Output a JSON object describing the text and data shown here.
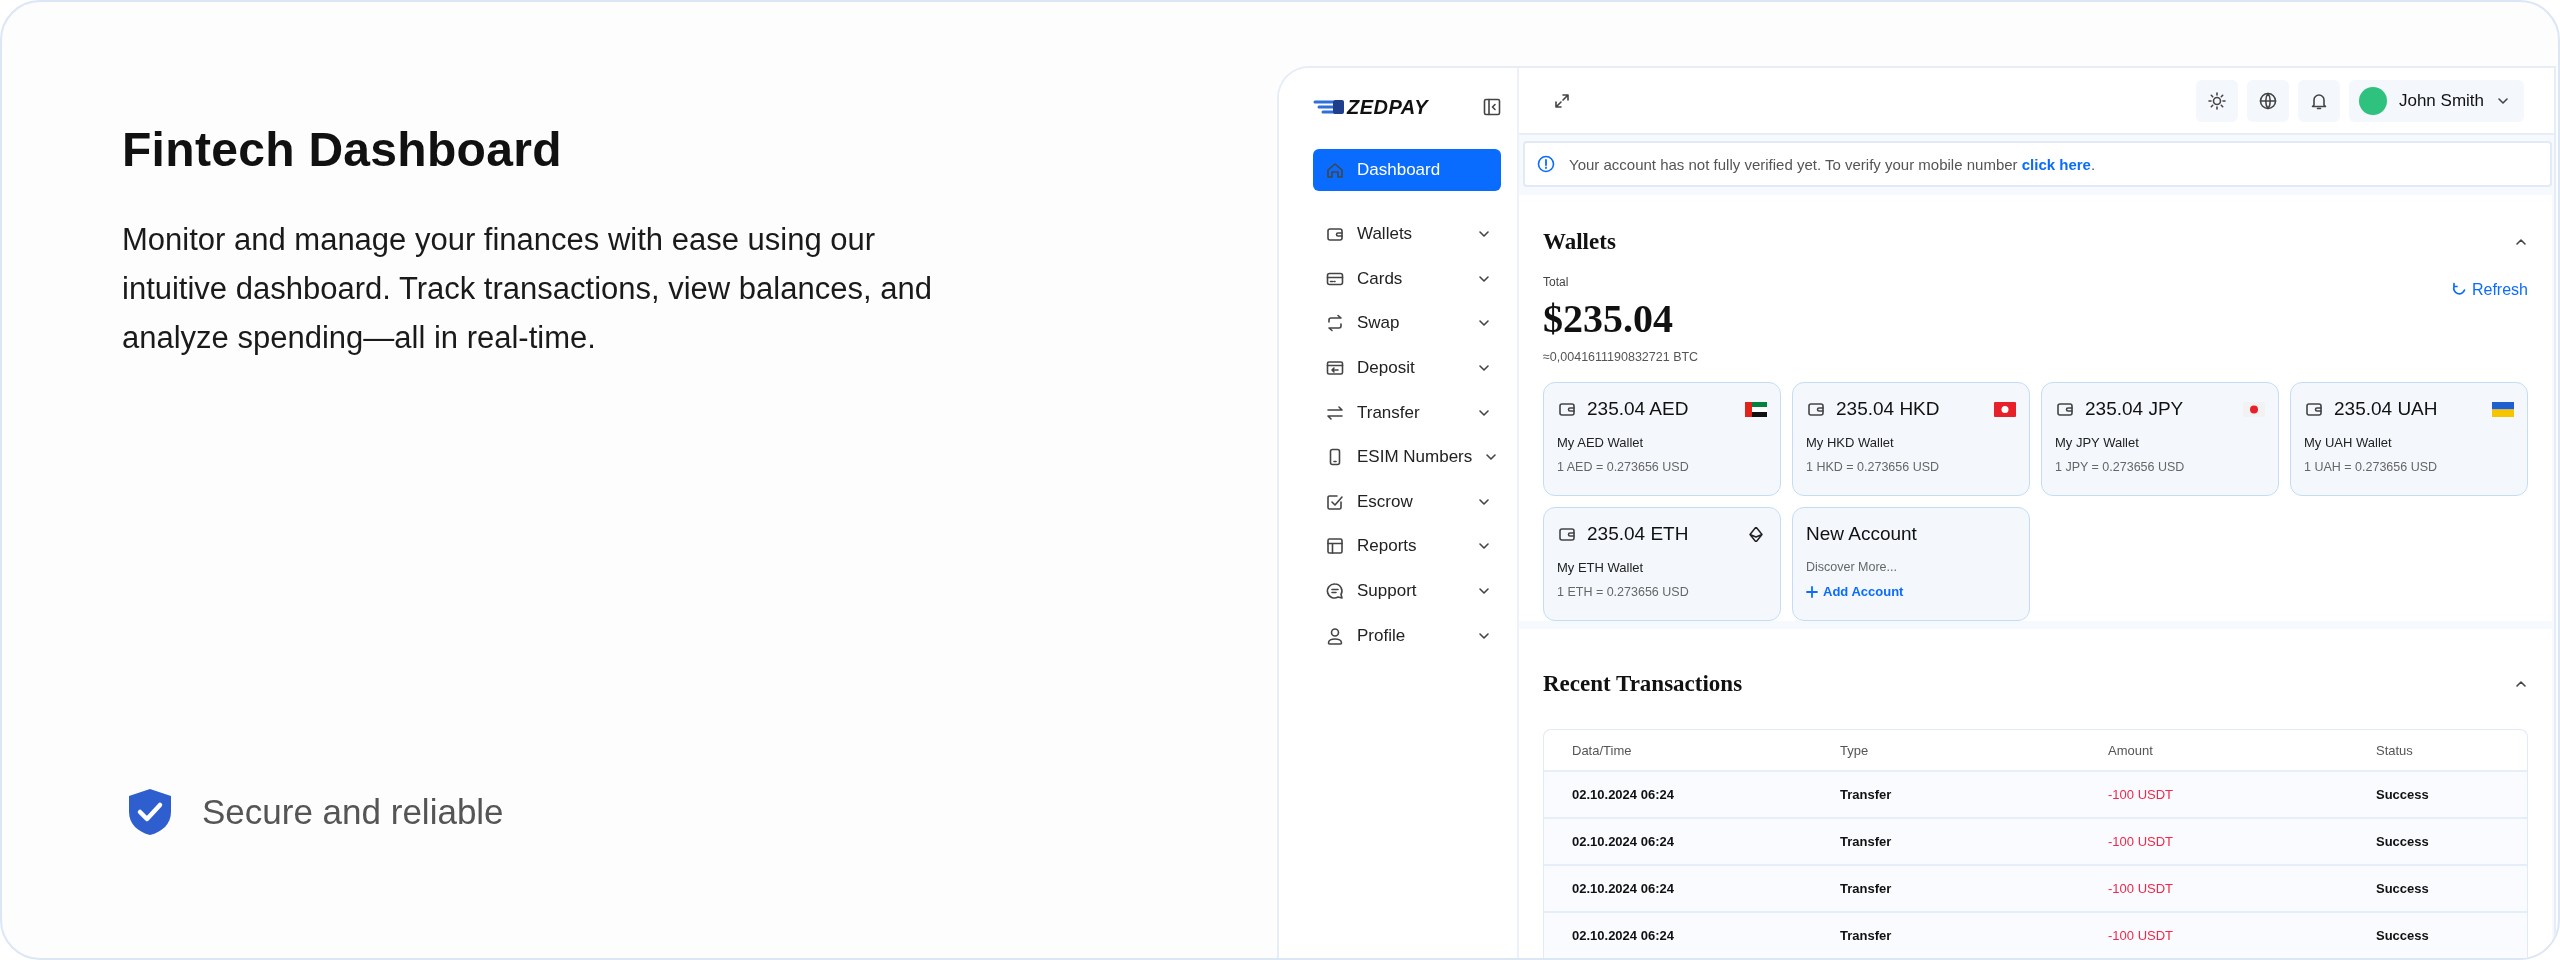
{
  "intro": {
    "title": "Fintech Dashboard",
    "description": "Monitor and manage your finances with ease using our intuitive dashboard. Track transactions, view balances, and analyze spending—all in real-time.",
    "badge": "Secure and reliable"
  },
  "sidebar": {
    "logo": "ZEDPAY",
    "items": [
      {
        "label": "Dashboard",
        "selected": true,
        "has_submenu": false
      },
      {
        "label": "Wallets",
        "selected": false,
        "has_submenu": true
      },
      {
        "label": "Cards",
        "selected": false,
        "has_submenu": true
      },
      {
        "label": "Swap",
        "selected": false,
        "has_submenu": true
      },
      {
        "label": "Deposit",
        "selected": false,
        "has_submenu": true
      },
      {
        "label": "Transfer",
        "selected": false,
        "has_submenu": true
      },
      {
        "label": "ESIM Numbers",
        "selected": false,
        "has_submenu": true
      },
      {
        "label": "Escrow",
        "selected": false,
        "has_submenu": true
      },
      {
        "label": "Reports",
        "selected": false,
        "has_submenu": true
      },
      {
        "label": "Support",
        "selected": false,
        "has_submenu": true
      },
      {
        "label": "Profile",
        "selected": false,
        "has_submenu": true
      }
    ]
  },
  "topbar": {
    "user_name": "John Smith"
  },
  "alert": {
    "message": "Your account has not fully verified yet. To verify your mobile number ",
    "link": "click here",
    "message_end": "."
  },
  "wallets": {
    "title": "Wallets",
    "total_label": "Total",
    "total": "$235.04",
    "btc_equivalent": "≈0,0041611190832721 BTC",
    "refresh": "Refresh",
    "cards": [
      {
        "kind": "wallet",
        "amount": "235.04 AED",
        "name": "My AED Wallet",
        "rate": "1 AED = 0.273656 USD"
      },
      {
        "kind": "wallet",
        "amount": "235.04 HKD",
        "name": "My HKD Wallet",
        "rate": "1 HKD = 0.273656 USD"
      },
      {
        "kind": "wallet",
        "amount": "235.04 JPY",
        "name": "My JPY Wallet",
        "rate": "1 JPY = 0.273656 USD"
      },
      {
        "kind": "wallet",
        "amount": "235.04 UAH",
        "name": "My UAH Wallet",
        "rate": "1 UAH = 0.273656 USD"
      },
      {
        "kind": "wallet",
        "amount": "235.04 ETH",
        "name": "My ETH Wallet",
        "rate": "1 ETH = 0.273656 USD"
      },
      {
        "kind": "new",
        "title": "New Account",
        "subtitle": "Discover More...",
        "action": "Add Account"
      }
    ]
  },
  "transactions": {
    "title": "Recent Transactions",
    "columns": [
      "Data/Time",
      "Type",
      "Amount",
      "Status"
    ],
    "rows": [
      [
        "02.10.2024 06:24",
        "Transfer",
        "-100 USDT",
        "Success"
      ],
      [
        "02.10.2024 06:24",
        "Transfer",
        "-100 USDT",
        "Success"
      ],
      [
        "02.10.2024 06:24",
        "Transfer",
        "-100 USDT",
        "Success"
      ],
      [
        "02.10.2024 06:24",
        "Transfer",
        "-100 USDT",
        "Success"
      ]
    ]
  }
}
